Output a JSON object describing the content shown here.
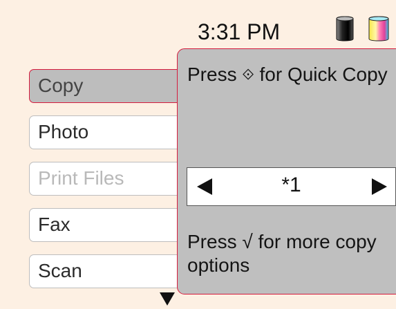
{
  "header": {
    "time": "3:31 PM",
    "ink_black_icon": "black-ink-cartridge-icon",
    "ink_color_icon": "color-ink-cartridge-icon"
  },
  "menu": {
    "items": [
      {
        "label": "Copy",
        "state": "selected"
      },
      {
        "label": "Photo",
        "state": "normal"
      },
      {
        "label": "Print Files",
        "state": "disabled"
      },
      {
        "label": "Fax",
        "state": "normal"
      },
      {
        "label": "Scan",
        "state": "normal"
      }
    ],
    "scroll_icon": "down-arrow-icon"
  },
  "panel": {
    "top_text_before": "Press",
    "top_text_after": "for Quick Copy",
    "quick_copy_icon": "diamond-icon",
    "copies_value": "*1",
    "left_icon": "left-arrow-icon",
    "right_icon": "right-arrow-icon",
    "bottom_text": "Press √ for more copy options"
  },
  "colors": {
    "background": "#fdf0e3",
    "selection_border": "#d51a3c",
    "panel_bg": "#bfbfbf",
    "disabled_text": "#b9b9b9"
  }
}
